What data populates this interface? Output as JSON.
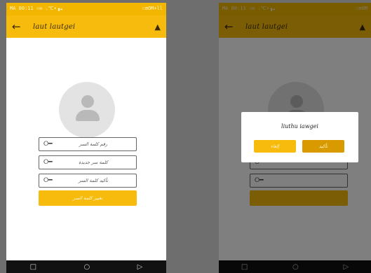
{
  "screens": [
    {
      "status": {
        "left": "MA 80:11 ☉✉ .℃∙▗☁",
        "right": "☐≡OM+ll"
      },
      "app_bar": {
        "title": "laut lautgei",
        "back_icon": "←",
        "bell_icon": "▲"
      },
      "fields": [
        {
          "icon": "⭘━",
          "text": "رقم كلمة السر"
        },
        {
          "icon": "⭘━",
          "text": "كلمة سر جديدة"
        },
        {
          "icon": "⭘━",
          "text": "تأكيد كلمة السر"
        }
      ],
      "button": "تغيير كلمة السر",
      "nav": [
        "□",
        "○",
        "▷"
      ]
    },
    {
      "status": {
        "left": "MA 80:11 ☉✉ .℃∙▗☁",
        "right": "☐≡OM"
      },
      "app_bar": {
        "title": "laut lautgei",
        "back_icon": "←",
        "bell_icon": "▲"
      },
      "dialog": {
        "title": "liuthu iawgei",
        "cancel": "إلغاء",
        "ok": "تأكيد"
      },
      "nav": [
        "□",
        "○",
        "▷"
      ]
    }
  ]
}
